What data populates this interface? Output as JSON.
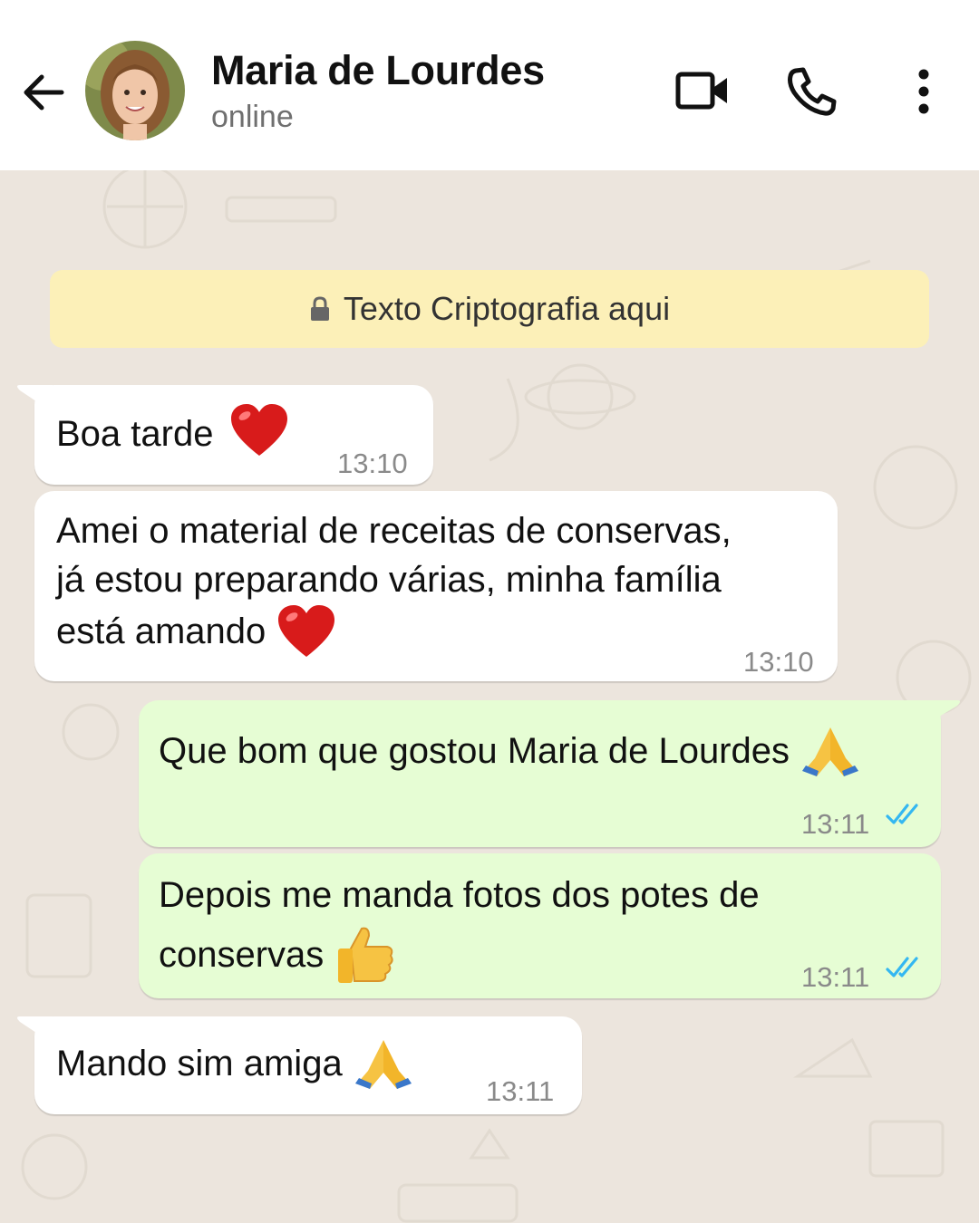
{
  "header": {
    "contact_name": "Maria de Lourdes",
    "status": "online"
  },
  "encryption_banner": "Texto Criptografia aqui",
  "messages": [
    {
      "direction": "in",
      "text": "Boa tarde",
      "emoji": "red-heart",
      "time": "13:10"
    },
    {
      "direction": "in",
      "lines": [
        "Amei o material de receitas de conservas,",
        "já estou preparando várias, minha família",
        "está amando"
      ],
      "emoji": "red-heart",
      "time": "13:10"
    },
    {
      "direction": "out",
      "text": "Que bom que gostou Maria de Lourdes",
      "emoji": "folded-hands",
      "time": "13:11",
      "status": "read"
    },
    {
      "direction": "out",
      "lines": [
        "Depois me manda fotos dos potes de",
        "conservas"
      ],
      "emoji": "thumbs-up",
      "time": "13:11",
      "status": "read"
    },
    {
      "direction": "in",
      "text": "Mando sim amiga",
      "emoji": "folded-hands",
      "time": "13:11"
    }
  ],
  "colors": {
    "chat_bg": "#ece5dd",
    "incoming_bubble": "#ffffff",
    "outgoing_bubble": "#e6fdd4",
    "banner_bg": "#fcf0b8",
    "read_ticks": "#34b7f1"
  }
}
